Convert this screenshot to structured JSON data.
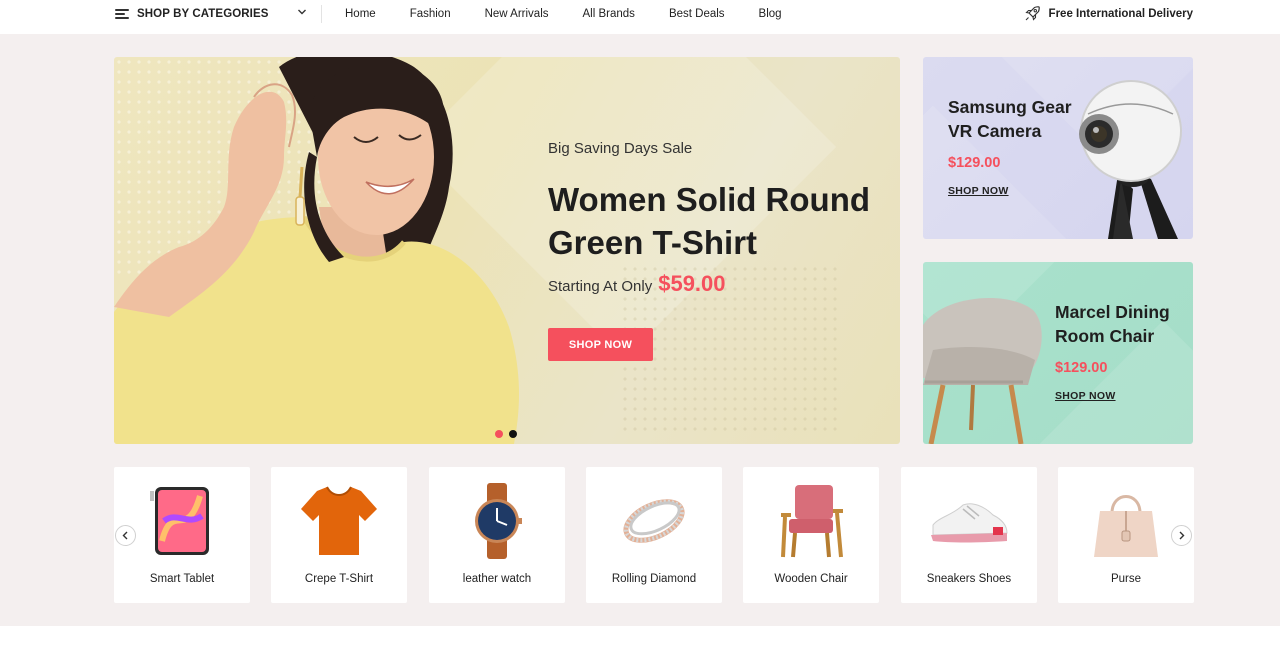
{
  "nav": {
    "categories_label": "SHOP BY CATEGORIES",
    "links": [
      "Home",
      "Fashion",
      "New Arrivals",
      "All Brands",
      "Best Deals",
      "Blog"
    ],
    "delivery_label": "Free International Delivery"
  },
  "hero": {
    "eyebrow": "Big Saving Days Sale",
    "title": "Women Solid Round Green T-Shirt",
    "price_prefix": "Starting At Only",
    "price": "$59.00",
    "button": "SHOP NOW",
    "slides_total": 2,
    "active_slide": 1
  },
  "side_banners": [
    {
      "name": "Samsung Gear VR Camera",
      "price": "$129.00",
      "link": "SHOP NOW"
    },
    {
      "name": "Marcel Dining Room Chair",
      "price": "$129.00",
      "link": "SHOP NOW"
    }
  ],
  "categories": [
    {
      "label": "Smart Tablet",
      "icon": "tablet-icon"
    },
    {
      "label": "Crepe T-Shirt",
      "icon": "tshirt-icon"
    },
    {
      "label": "leather watch",
      "icon": "watch-icon"
    },
    {
      "label": "Rolling Diamond",
      "icon": "ring-icon"
    },
    {
      "label": "Wooden Chair",
      "icon": "armchair-icon"
    },
    {
      "label": "Sneakers Shoes",
      "icon": "sneaker-icon"
    },
    {
      "label": "Purse",
      "icon": "handbag-icon"
    }
  ],
  "colors": {
    "accent": "#f5505d",
    "background": "#f4efef",
    "hero_bg": "#ece3b6",
    "banner_vr_bg": "#d8d8f0",
    "banner_chair_bg": "#a8e0cb"
  }
}
